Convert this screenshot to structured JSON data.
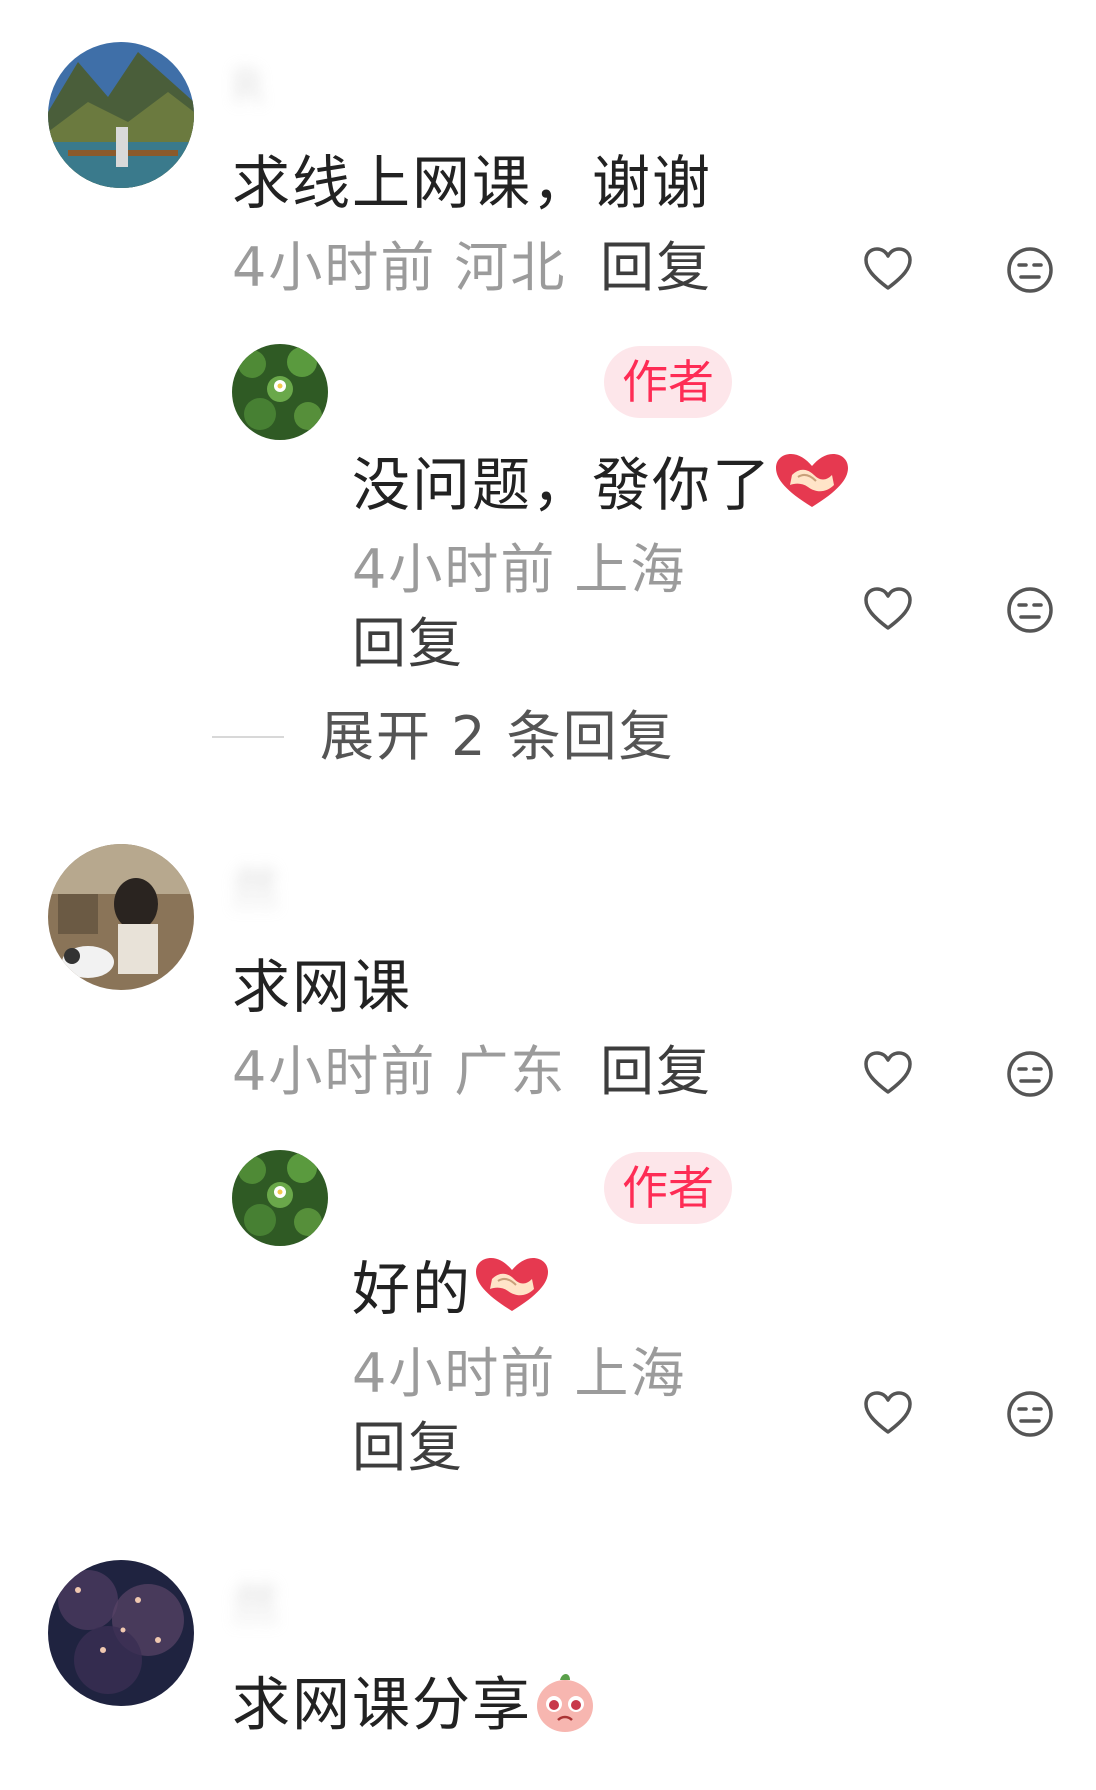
{
  "reply_label": "回复",
  "author_badge": "作者",
  "comments": [
    {
      "username": "R",
      "text": "求线上网课，谢谢",
      "time": "4小时前",
      "location": "河北",
      "reply_label": "回复",
      "replies": [
        {
          "username": "",
          "badge": "作者",
          "text": "没问题，發你了",
          "time": "4小时前",
          "location": "上海",
          "reply_label": "回复"
        }
      ],
      "expand_label": "展开 2 条回复"
    },
    {
      "username": "然",
      "text": "求网课",
      "time": "4小时前",
      "location": "广东",
      "reply_label": "回复",
      "replies": [
        {
          "username": "",
          "badge": "作者",
          "text": "好的",
          "time": "4小时前",
          "location": "上海",
          "reply_label": "回复"
        }
      ]
    },
    {
      "username": "然",
      "text": "求网课分享"
    }
  ],
  "icons": {
    "like": "heart-outline-icon",
    "dislike": "neutral-face-icon",
    "handshake_emoji": "handshake-heart-emoji",
    "pleading_emoji": "pleading-face-emoji"
  },
  "colors": {
    "accent": "#fe2c55",
    "badge_bg": "#fde6ea",
    "text_primary": "#222222",
    "text_meta": "#9b9b9b"
  }
}
